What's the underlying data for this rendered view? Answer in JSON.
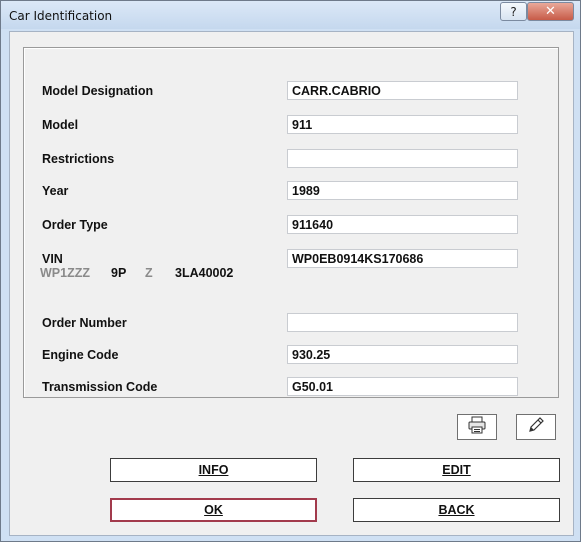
{
  "window": {
    "title": "Car Identification",
    "help_label": "?",
    "close_label": "✕"
  },
  "fields": [
    {
      "label": "Model Designation",
      "value": "CARR.CABRIO"
    },
    {
      "label": "Model",
      "value": "911"
    },
    {
      "label": "Restrictions",
      "value": ""
    },
    {
      "label": "Year",
      "value": "1989"
    },
    {
      "label": "Order Type",
      "value": "911640"
    },
    {
      "label": "VIN",
      "value": "WP0EB0914KS170686"
    },
    {
      "label": "Order Number",
      "value": ""
    },
    {
      "label": "Engine Code",
      "value": "930.25"
    },
    {
      "label": "Transmission Code",
      "value": "G50.01"
    }
  ],
  "vin_breakdown": {
    "wmi": "WP1ZZZ",
    "model_code": "9P",
    "filler": "Z",
    "serial": "3LA40002"
  },
  "icons": {
    "print": "printer-icon",
    "edit": "pencil-icon"
  },
  "buttons": {
    "info": "INFO",
    "edit": "EDIT",
    "ok": "OK",
    "back": "BACK"
  }
}
